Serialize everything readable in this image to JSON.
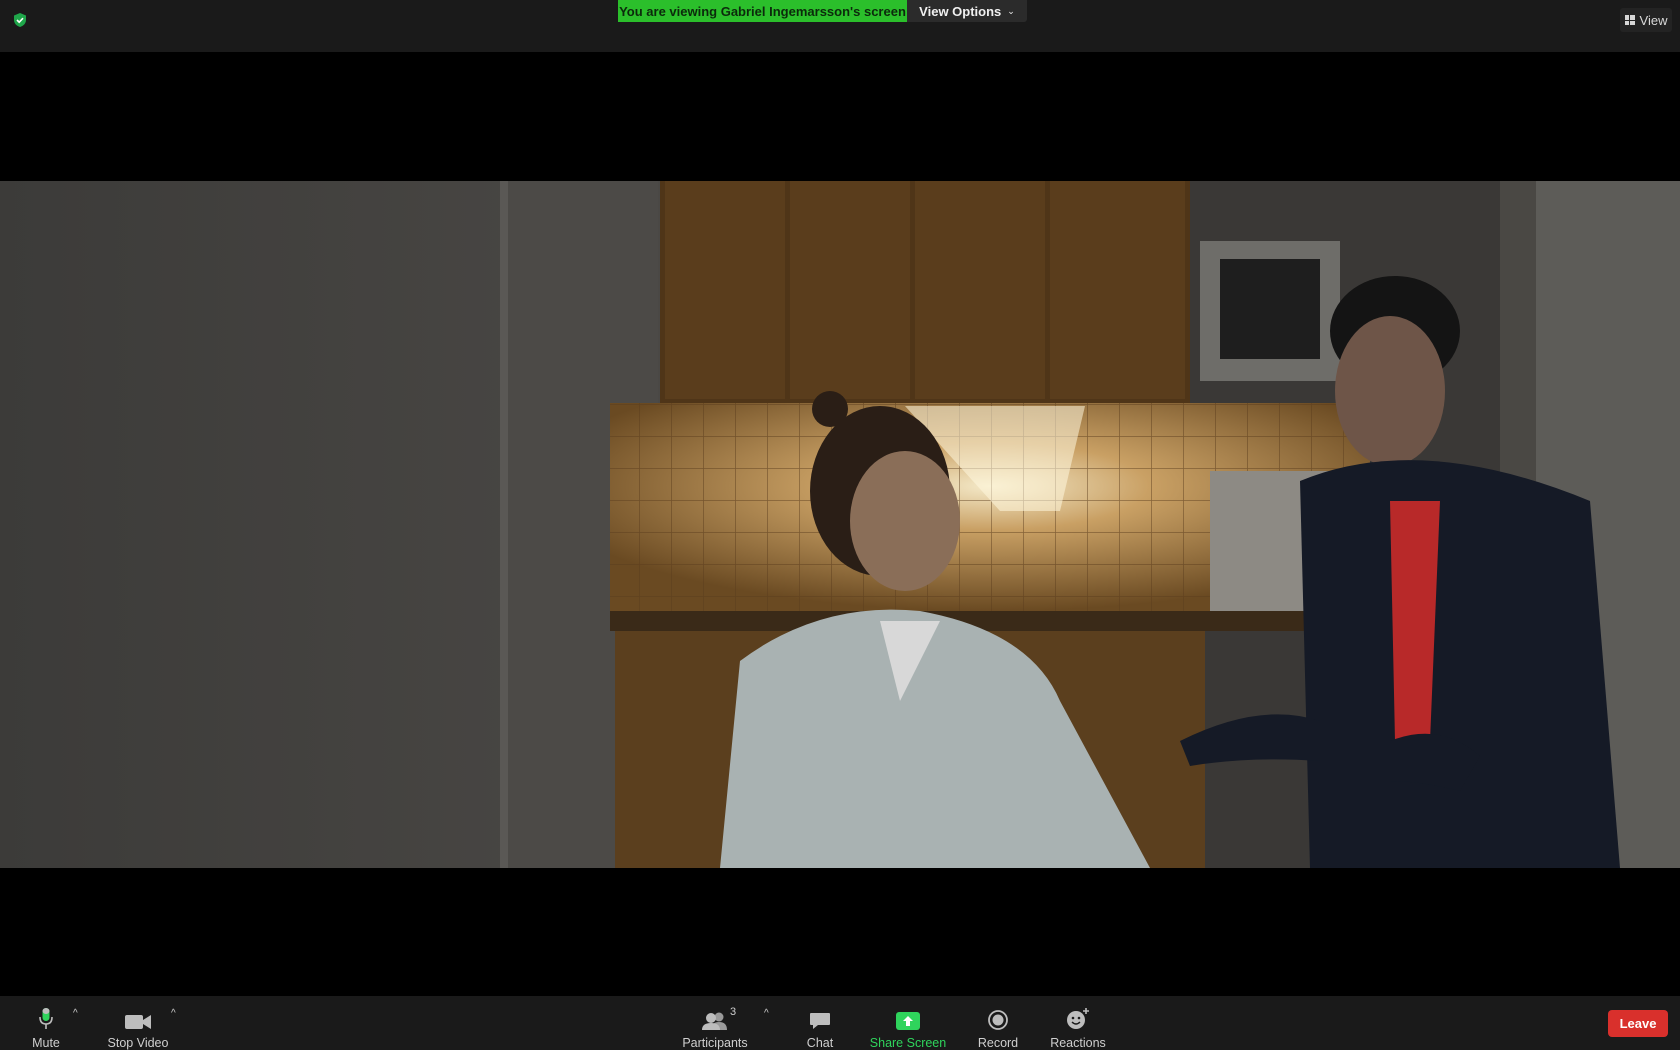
{
  "topbar": {
    "viewing_banner": "You are viewing Gabriel Ingemarsson's screen",
    "view_options_label": "View Options",
    "view_label": "View"
  },
  "shared_screen": {
    "content": "video-frame"
  },
  "toolbar": {
    "mute_label": "Mute",
    "stop_video_label": "Stop Video",
    "participants_label": "Participants",
    "participants_count": "3",
    "chat_label": "Chat",
    "share_screen_label": "Share Screen",
    "record_label": "Record",
    "reactions_label": "Reactions",
    "leave_label": "Leave"
  },
  "colors": {
    "banner_green": "#2bbf2b",
    "share_green": "#2fd45c",
    "leave_red": "#d9302c",
    "shield_green": "#1fa64a"
  },
  "icons": [
    "shield-icon",
    "chevron-down-icon",
    "grid-icon",
    "microphone-icon",
    "video-camera-icon",
    "participants-icon",
    "chat-icon",
    "share-screen-icon",
    "record-icon",
    "reactions-icon"
  ]
}
